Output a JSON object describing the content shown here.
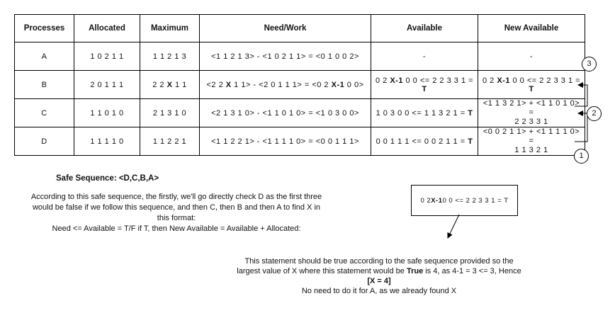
{
  "table": {
    "headers": [
      "Processes",
      "Allocated",
      "Maximum",
      "Need/Work",
      "Available",
      "New Available"
    ],
    "rows": [
      {
        "process": "A",
        "allocated": "1 0 2 1 1",
        "maximum": "1 1 2 1 3",
        "need": "<1 1 2 1 3> - <1 0 2 1 1> = <0 1 0 0 2>",
        "available": "-",
        "new_available": "-"
      },
      {
        "process": "B",
        "allocated": "2 0 1 1 1",
        "maximum_pre": "2 2 ",
        "maximum_x": "X",
        "maximum_post": " 1 1",
        "need_a": "<2 2 ",
        "need_x": "X",
        "need_b": " 1 1> - <2 0 1 1 1> = <0 2 ",
        "need_x1": "X-1",
        "need_c": " 0 0>",
        "avail_a": "0 2 ",
        "avail_x1": "X-1",
        "avail_b": " 0 0 <= 2 2 3 3 1 = ",
        "avail_t": "T",
        "new_a": "0 2 ",
        "new_x1": "X-1",
        "new_b": " 0 0 <= 2 2 3 3 1 = ",
        "new_t": "T"
      },
      {
        "process": "C",
        "allocated": "1 1 0 1 0",
        "maximum": "2 1 3 1 0",
        "need": "<2 1 3 1 0> - <1 1 0 1 0> = <1 0 3 0 0>",
        "avail_a": "1 0 3 0 0 <= 1 1 3 2 1 = ",
        "avail_t": "T",
        "new_line1": "<1 1 3 2 1> + <1 1 0 1 0> =",
        "new_line2": "2 2 3 3 1"
      },
      {
        "process": "D",
        "allocated": "1 1 1 1 0",
        "maximum": "1 1 2 2 1",
        "need": "<1 1 2 2 1> - <1 1 1 1 0> = <0 0 1 1 1>",
        "avail_a": "0 0 1 1 1 <= 0 0 2 1 1 = ",
        "avail_t": "T",
        "new_line1": "<0 0 2 1 1> + <1 1 1 1 0> =",
        "new_line2": "1 1 3 2 1"
      }
    ]
  },
  "steps": [
    "1",
    "2",
    "3"
  ],
  "safe_sequence": "Safe Sequence: <D,C,B,A>",
  "explanation": {
    "line1": "According to this safe sequence, the firstly, we'll go directly check D as the first three",
    "line2": "would be false if we follow this sequence, and then C, then B and then A to find X in",
    "line3": "this format:",
    "line4": "Need <= Available = T/F if T, then New Available = Available + Allocated:"
  },
  "callout": {
    "a": "0 2 ",
    "x1": "X-1",
    "b": " 0 0 <= 2 2 3 3 1 = T"
  },
  "conclusion": {
    "line1": "This statement should be true according to the safe sequence provided so the",
    "line2_a": "largest value of X where this statement would be ",
    "line2_true": "True",
    "line2_b": " is 4, as 4-1 = 3 <= 3, Hence",
    "line3": "[X = 4]",
    "line4": "No need to do it for A, as we already found X"
  }
}
